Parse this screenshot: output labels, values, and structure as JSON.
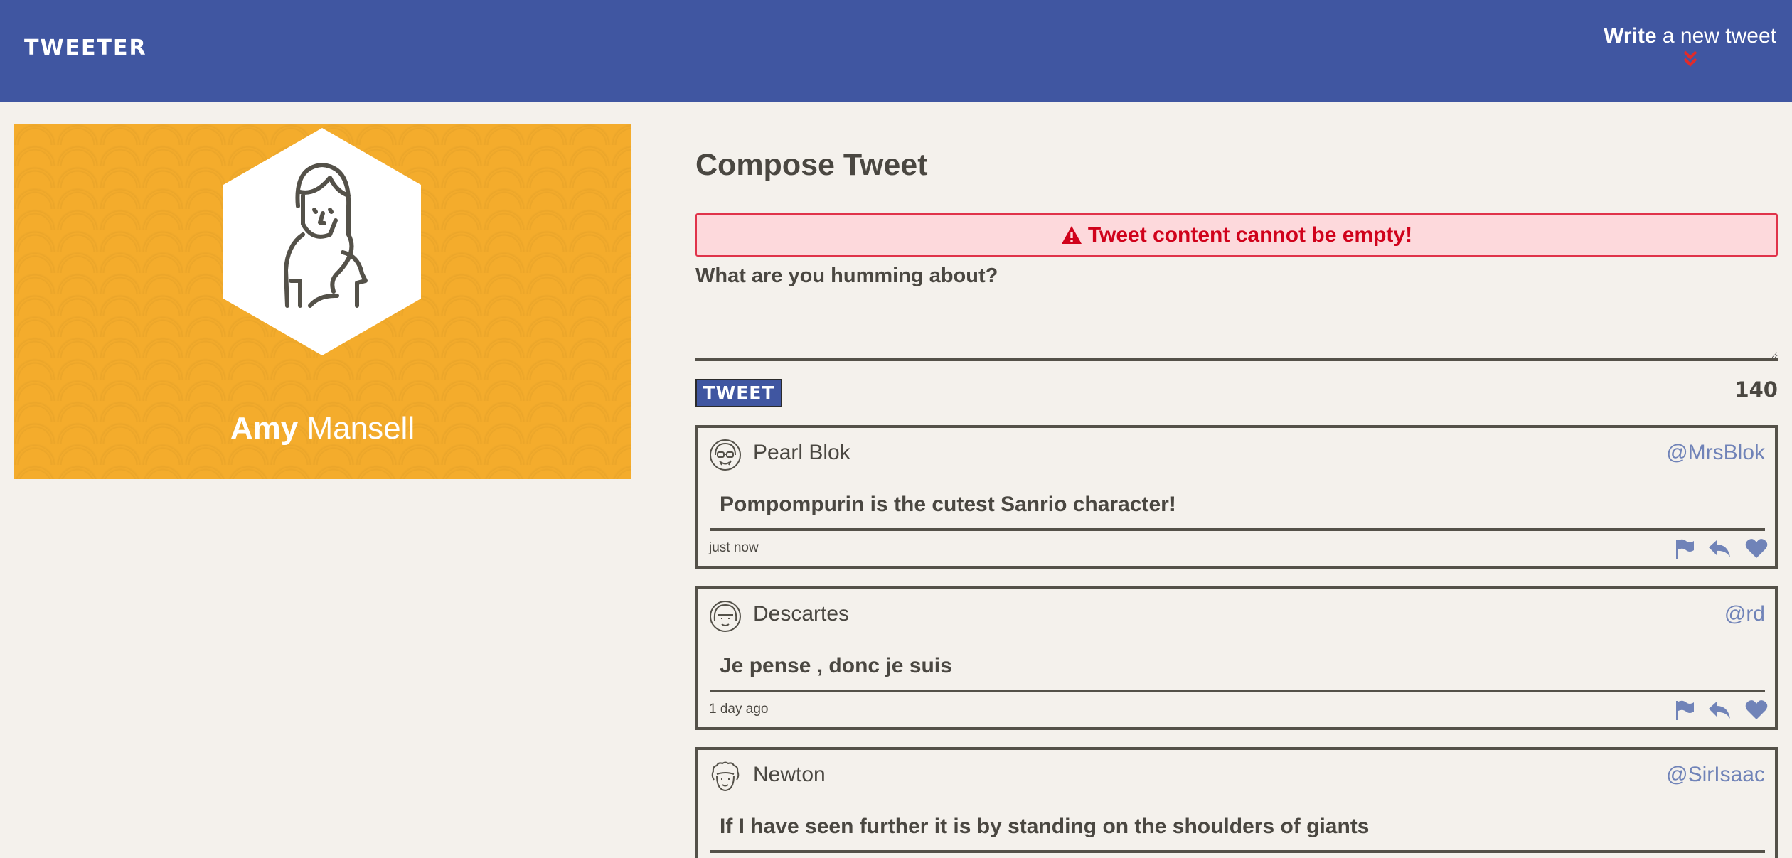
{
  "nav": {
    "brand": "TWEETER",
    "write_bold": "Write",
    "write_rest": " a new tweet",
    "write_icon": "double-chevron-down-icon"
  },
  "profile": {
    "first_name": "Amy",
    "last_name": " Mansell",
    "avatar_icon": "woman-avatar-icon"
  },
  "compose": {
    "title": "Compose Tweet",
    "error": "Tweet content cannot be empty!",
    "placeholder": "What are you humming about?",
    "button": "TWEET",
    "counter": "140"
  },
  "tweets": [
    {
      "name": "Pearl Blok",
      "handle": "@MrsBlok",
      "content": "Pompompurin is the cutest Sanrio character!",
      "time": "just now",
      "avatar_icon": "woman-glasses-avatar-icon"
    },
    {
      "name": "Descartes",
      "handle": "@rd",
      "content": "Je pense , donc je suis",
      "time": "1 day ago",
      "avatar_icon": "man-bob-avatar-icon"
    },
    {
      "name": "Newton",
      "handle": "@SirIsaac",
      "content": "If I have seen further it is by standing on the shoulders of giants",
      "time": "",
      "avatar_icon": "man-curly-hair-avatar-icon"
    }
  ],
  "colors": {
    "nav_bg": "#4056a1",
    "profile_bg": "#f4ac2c",
    "page_bg": "#f4f1ec",
    "error_text": "#d0021b",
    "handle": "#7083b8"
  }
}
